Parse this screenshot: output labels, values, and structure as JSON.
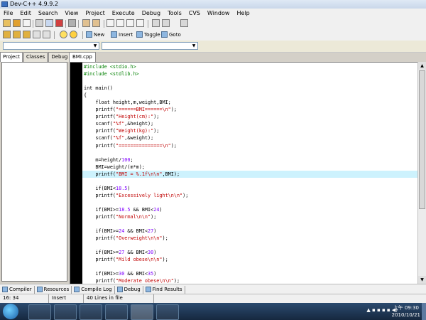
{
  "window": {
    "title": "Dev-C++ 4.9.9.2"
  },
  "menu": [
    "File",
    "Edit",
    "Search",
    "View",
    "Project",
    "Execute",
    "Debug",
    "Tools",
    "CVS",
    "Window",
    "Help"
  ],
  "toolbar2": {
    "new": "New",
    "insert": "Insert",
    "toggle": "Toggle",
    "goto": "Goto"
  },
  "left_tabs": [
    "Project",
    "Classes",
    "Debug"
  ],
  "editor_tab": "BMI.cpp",
  "code": [
    "#include <stdio.h>",
    "#include <stdlib.h>",
    "",
    "int main()",
    "{",
    "    float height,m,weight,BMI;",
    "    printf(\"======BMI======\\n\");",
    "    printf(\"Height(cm):\");",
    "    scanf(\"%f\",&height);",
    "    printf(\"Weight(kg):\");",
    "    scanf(\"%f\",&weight);",
    "    printf(\"===============\\n\");",
    "",
    "    m=height/100;",
    "    BMI=weight/(m*m);",
    "    printf(\"BMI = %.1f\\n\\n\",BMI);",
    "",
    "    if(BMI<18.5)",
    "    printf(\"Excessively light\\n\\n\");",
    "",
    "    if(BMI>=18.5 && BMI<24)",
    "    printf(\"Normal\\n\\n\");",
    "",
    "    if(BMI>=24 && BMI<27)",
    "    printf(\"Overweight\\n\\n\");",
    "",
    "    if(BMI>=27 && BMI<30)",
    "    printf(\"Mild obese\\n\\n\");",
    "",
    "    if(BMI>=30 && BMI<35)",
    "    printf(\"Moderate obese\\n\\n\");"
  ],
  "highlight_line": 15,
  "bottom_tabs": [
    "Compiler",
    "Resources",
    "Compile Log",
    "Debug",
    "Find Results"
  ],
  "status": {
    "position": "16: 34",
    "mode": "Insert",
    "lines": "40 Lines in file"
  },
  "clock": {
    "time": "上午 09:30",
    "date": "2010/10/21"
  },
  "colors": {
    "highlight": "#cdf2fd",
    "string": "#c00000",
    "preprocessor": "#008000",
    "number": "#8000ff"
  }
}
